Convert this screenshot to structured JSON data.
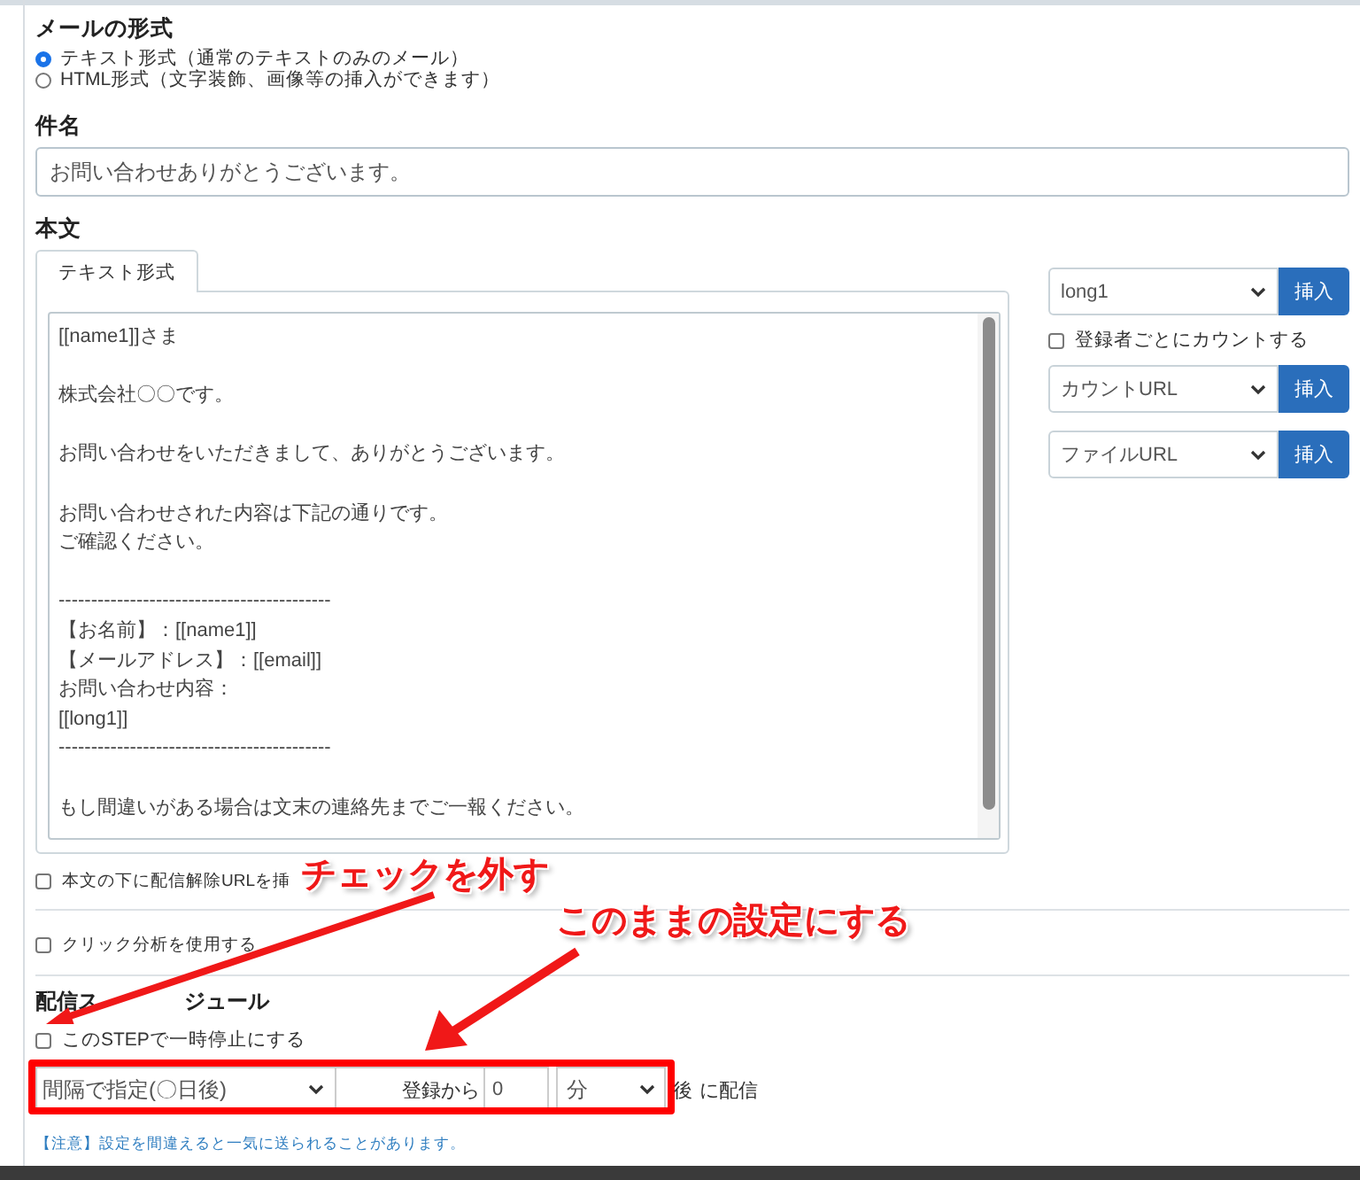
{
  "mail_format": {
    "heading": "メールの形式",
    "options": [
      {
        "label": "テキスト形式（通常のテキストのみのメール）",
        "selected": true
      },
      {
        "label": "HTML形式（文字装飾、画像等の挿入ができます）",
        "selected": false
      }
    ]
  },
  "subject": {
    "heading": "件名",
    "value": "お問い合わせありがとうございます。"
  },
  "body": {
    "heading": "本文",
    "tabs": [
      {
        "label": "テキスト形式",
        "selected": true
      }
    ],
    "paragraphs": [
      [
        "[[name1]]さま"
      ],
      [
        "株式会社〇〇です。"
      ],
      [
        "お問い合わせをいただきまして、ありがとうございます。"
      ],
      [
        "お問い合わせされた内容は下記の通りです。",
        "ご確認ください。"
      ],
      [
        "------------------------------------------",
        "【お名前】：[[name1]]",
        "【メールアドレス】：[[email]]",
        "お問い合わせ内容：",
        "[[long1]]",
        "------------------------------------------"
      ],
      [
        "もし間違いがある場合は文末の連絡先までご一報ください。"
      ]
    ]
  },
  "insert_panel": [
    {
      "kind": "select",
      "value": "long1",
      "button": "挿入"
    },
    {
      "kind": "checkbox",
      "label": "登録者ごとにカウントする",
      "checked": false
    },
    {
      "kind": "select",
      "value": "カウントURL",
      "button": "挿入"
    },
    {
      "kind": "select",
      "value": "ファイルURL",
      "button": "挿入"
    }
  ],
  "options": [
    {
      "label": "本文の下に配信解除URLを挿",
      "checked": false
    },
    {
      "label": "クリック分析を使用する",
      "checked": false
    }
  ],
  "schedule": {
    "heading_parts": [
      "配信ス",
      "ジュール"
    ],
    "pause": {
      "label": "このSTEPで一時停止にする",
      "checked": false
    },
    "mode": "間隔で指定(〇日後)",
    "from_label": "登録から",
    "amount": "0",
    "unit": "分",
    "suffix_1": "後",
    "suffix_2": "に配信",
    "note": "【注意】設定を間違えると一気に送られることがあります。"
  },
  "annotations": [
    {
      "text": "チェックを外す"
    },
    {
      "text": "このままの設定にする"
    }
  ]
}
